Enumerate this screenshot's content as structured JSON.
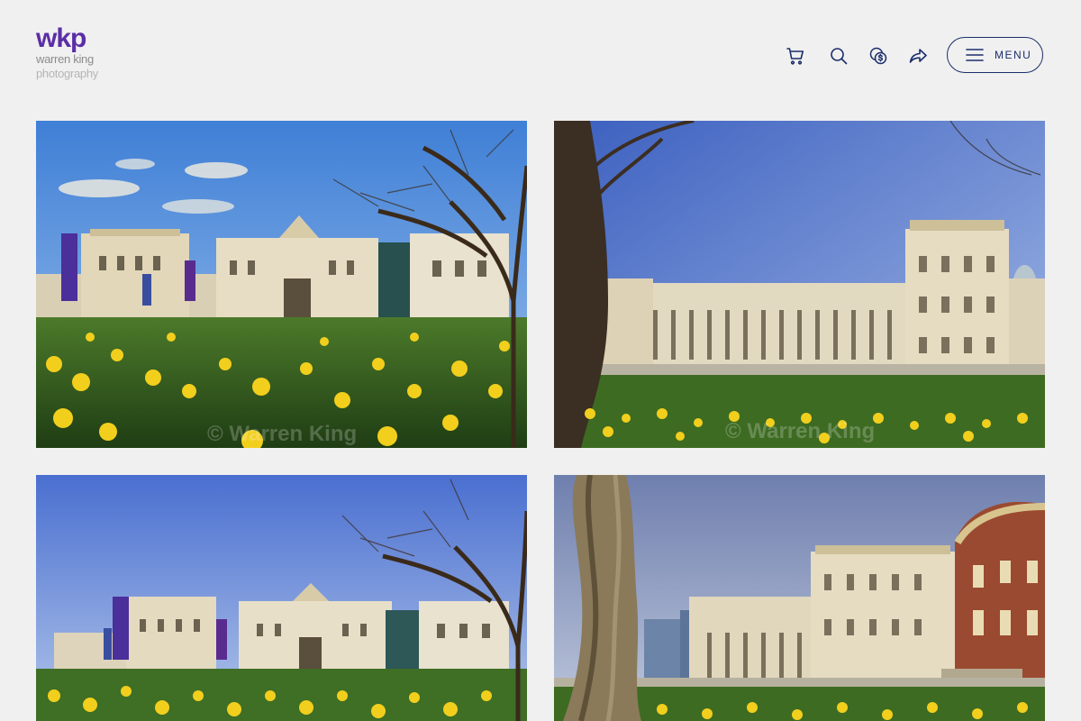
{
  "brand": {
    "logo_mark": "wkp",
    "logo_line1": "warren king",
    "logo_line2": "photography",
    "color": "#5b2ea6"
  },
  "header": {
    "icons": [
      "cart-icon",
      "search-icon",
      "currency-icon",
      "share-icon"
    ],
    "menu_label": "MENU",
    "accent": "#1b2e6b"
  },
  "gallery": {
    "photos": [
      {
        "subject": "photo-1",
        "watermark": "© Warren King"
      },
      {
        "subject": "photo-2",
        "watermark": "© Warren King"
      },
      {
        "subject": "photo-3",
        "watermark": ""
      },
      {
        "subject": "photo-4",
        "watermark": ""
      }
    ]
  }
}
